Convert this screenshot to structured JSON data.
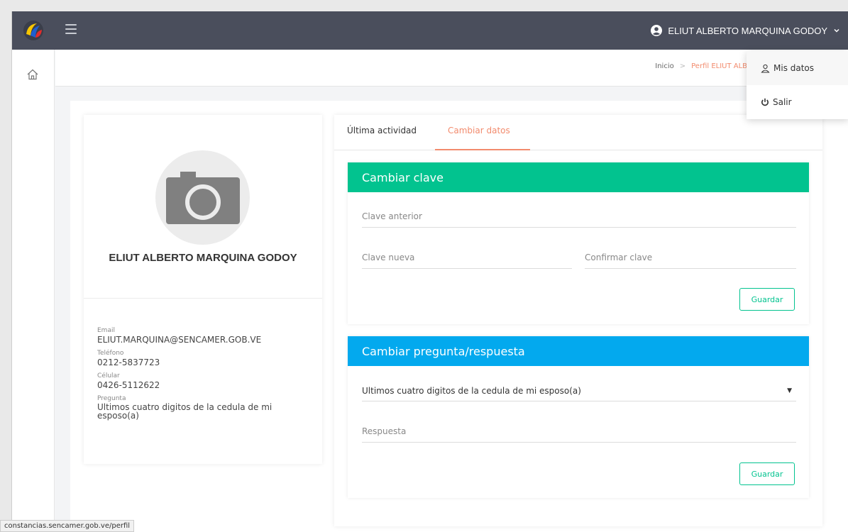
{
  "topbar": {
    "user_name": "ELIUT ALBERTO MARQUINA GODOY"
  },
  "breadcrumb": {
    "home": "Inicio",
    "current": "Perfil ELIUT ALBI"
  },
  "user_dropdown": {
    "items": [
      {
        "label": "Mis datos",
        "icon": "user-icon"
      },
      {
        "label": "Salir",
        "icon": "power-icon"
      }
    ]
  },
  "profile": {
    "name": "ELIUT ALBERTO MARQUINA GODOY",
    "email_label": "Email",
    "email": "ELIUT.MARQUINA@SENCAMER.GOB.VE",
    "phone_label": "Teléfono",
    "phone": "0212-5837723",
    "cell_label": "Célular",
    "cell": "0426-5112622",
    "question_label": "Pregunta",
    "question": "Ultimos cuatro digitos de la cedula de mi esposo(a)"
  },
  "tabs": [
    {
      "label": "Última actividad"
    },
    {
      "label": "Cambiar datos",
      "active": true
    }
  ],
  "change_password": {
    "title": "Cambiar clave",
    "old_placeholder": "Clave anterior",
    "new_placeholder": "Clave nueva",
    "confirm_placeholder": "Confirmar clave",
    "save_label": "Guardar"
  },
  "change_question": {
    "title": "Cambiar pregunta/respuesta",
    "selected_question": "Ultimos cuatro digitos de la cedula de mi esposo(a)",
    "answer_placeholder": "Respuesta",
    "save_label": "Guardar"
  },
  "statusbar": {
    "url": "constancias.sencamer.gob.ve/perfil"
  },
  "colors": {
    "topbar": "#4a4e5c",
    "accent_orange": "#f28b6d",
    "green": "#02c38f",
    "blue": "#03a9ee"
  }
}
